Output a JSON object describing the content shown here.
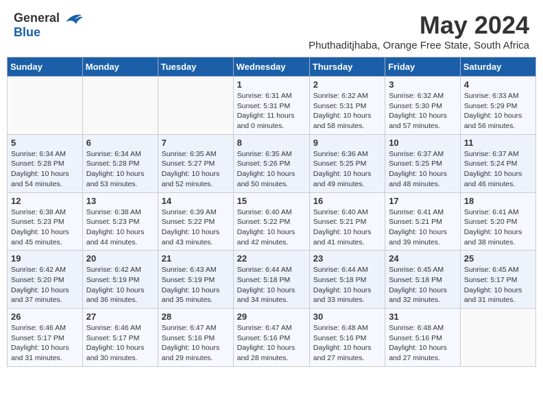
{
  "header": {
    "logo_general": "General",
    "logo_blue": "Blue",
    "month": "May 2024",
    "location": "Phuthaditjhaba, Orange Free State, South Africa"
  },
  "weekdays": [
    "Sunday",
    "Monday",
    "Tuesday",
    "Wednesday",
    "Thursday",
    "Friday",
    "Saturday"
  ],
  "weeks": [
    [
      {
        "day": "",
        "info": ""
      },
      {
        "day": "",
        "info": ""
      },
      {
        "day": "",
        "info": ""
      },
      {
        "day": "1",
        "info": "Sunrise: 6:31 AM\nSunset: 5:31 PM\nDaylight: 11 hours\nand 0 minutes."
      },
      {
        "day": "2",
        "info": "Sunrise: 6:32 AM\nSunset: 5:31 PM\nDaylight: 10 hours\nand 58 minutes."
      },
      {
        "day": "3",
        "info": "Sunrise: 6:32 AM\nSunset: 5:30 PM\nDaylight: 10 hours\nand 57 minutes."
      },
      {
        "day": "4",
        "info": "Sunrise: 6:33 AM\nSunset: 5:29 PM\nDaylight: 10 hours\nand 56 minutes."
      }
    ],
    [
      {
        "day": "5",
        "info": "Sunrise: 6:34 AM\nSunset: 5:28 PM\nDaylight: 10 hours\nand 54 minutes."
      },
      {
        "day": "6",
        "info": "Sunrise: 6:34 AM\nSunset: 5:28 PM\nDaylight: 10 hours\nand 53 minutes."
      },
      {
        "day": "7",
        "info": "Sunrise: 6:35 AM\nSunset: 5:27 PM\nDaylight: 10 hours\nand 52 minutes."
      },
      {
        "day": "8",
        "info": "Sunrise: 6:35 AM\nSunset: 5:26 PM\nDaylight: 10 hours\nand 50 minutes."
      },
      {
        "day": "9",
        "info": "Sunrise: 6:36 AM\nSunset: 5:25 PM\nDaylight: 10 hours\nand 49 minutes."
      },
      {
        "day": "10",
        "info": "Sunrise: 6:37 AM\nSunset: 5:25 PM\nDaylight: 10 hours\nand 48 minutes."
      },
      {
        "day": "11",
        "info": "Sunrise: 6:37 AM\nSunset: 5:24 PM\nDaylight: 10 hours\nand 46 minutes."
      }
    ],
    [
      {
        "day": "12",
        "info": "Sunrise: 6:38 AM\nSunset: 5:23 PM\nDaylight: 10 hours\nand 45 minutes."
      },
      {
        "day": "13",
        "info": "Sunrise: 6:38 AM\nSunset: 5:23 PM\nDaylight: 10 hours\nand 44 minutes."
      },
      {
        "day": "14",
        "info": "Sunrise: 6:39 AM\nSunset: 5:22 PM\nDaylight: 10 hours\nand 43 minutes."
      },
      {
        "day": "15",
        "info": "Sunrise: 6:40 AM\nSunset: 5:22 PM\nDaylight: 10 hours\nand 42 minutes."
      },
      {
        "day": "16",
        "info": "Sunrise: 6:40 AM\nSunset: 5:21 PM\nDaylight: 10 hours\nand 41 minutes."
      },
      {
        "day": "17",
        "info": "Sunrise: 6:41 AM\nSunset: 5:21 PM\nDaylight: 10 hours\nand 39 minutes."
      },
      {
        "day": "18",
        "info": "Sunrise: 6:41 AM\nSunset: 5:20 PM\nDaylight: 10 hours\nand 38 minutes."
      }
    ],
    [
      {
        "day": "19",
        "info": "Sunrise: 6:42 AM\nSunset: 5:20 PM\nDaylight: 10 hours\nand 37 minutes."
      },
      {
        "day": "20",
        "info": "Sunrise: 6:42 AM\nSunset: 5:19 PM\nDaylight: 10 hours\nand 36 minutes."
      },
      {
        "day": "21",
        "info": "Sunrise: 6:43 AM\nSunset: 5:19 PM\nDaylight: 10 hours\nand 35 minutes."
      },
      {
        "day": "22",
        "info": "Sunrise: 6:44 AM\nSunset: 5:18 PM\nDaylight: 10 hours\nand 34 minutes."
      },
      {
        "day": "23",
        "info": "Sunrise: 6:44 AM\nSunset: 5:18 PM\nDaylight: 10 hours\nand 33 minutes."
      },
      {
        "day": "24",
        "info": "Sunrise: 6:45 AM\nSunset: 5:18 PM\nDaylight: 10 hours\nand 32 minutes."
      },
      {
        "day": "25",
        "info": "Sunrise: 6:45 AM\nSunset: 5:17 PM\nDaylight: 10 hours\nand 31 minutes."
      }
    ],
    [
      {
        "day": "26",
        "info": "Sunrise: 6:46 AM\nSunset: 5:17 PM\nDaylight: 10 hours\nand 31 minutes."
      },
      {
        "day": "27",
        "info": "Sunrise: 6:46 AM\nSunset: 5:17 PM\nDaylight: 10 hours\nand 30 minutes."
      },
      {
        "day": "28",
        "info": "Sunrise: 6:47 AM\nSunset: 5:16 PM\nDaylight: 10 hours\nand 29 minutes."
      },
      {
        "day": "29",
        "info": "Sunrise: 6:47 AM\nSunset: 5:16 PM\nDaylight: 10 hours\nand 28 minutes."
      },
      {
        "day": "30",
        "info": "Sunrise: 6:48 AM\nSunset: 5:16 PM\nDaylight: 10 hours\nand 27 minutes."
      },
      {
        "day": "31",
        "info": "Sunrise: 6:48 AM\nSunset: 5:16 PM\nDaylight: 10 hours\nand 27 minutes."
      },
      {
        "day": "",
        "info": ""
      }
    ]
  ]
}
